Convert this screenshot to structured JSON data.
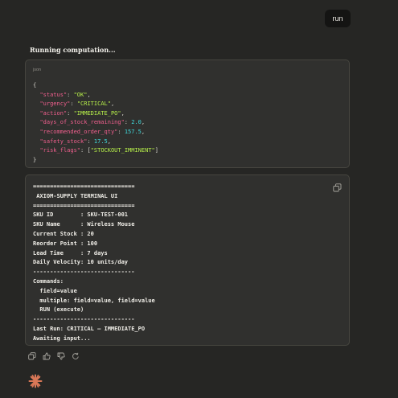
{
  "user_message": "run",
  "status_text": "Running computation...",
  "code_block": {
    "language": "json",
    "open": "{",
    "close": "}",
    "entries": [
      {
        "key": "\"status\"",
        "value": "\"OK\"",
        "type": "string"
      },
      {
        "key": "\"urgency\"",
        "value": "\"CRITICAL\"",
        "type": "string"
      },
      {
        "key": "\"action\"",
        "value": "\"IMMEDIATE_PO\"",
        "type": "string"
      },
      {
        "key": "\"days_of_stock_remaining\"",
        "value": "2.0",
        "type": "number"
      },
      {
        "key": "\"recommended_order_qty\"",
        "value": "157.5",
        "type": "number"
      },
      {
        "key": "\"safety_stock\"",
        "value": "17.5",
        "type": "number"
      },
      {
        "key": "\"risk_flags\"",
        "value": "\"STOCKOUT_IMMINENT\"",
        "type": "array"
      }
    ]
  },
  "terminal": {
    "lines": [
      "==============================",
      " AXIOM-SUPPLY TERMINAL UI",
      "==============================",
      "SKU ID        : SKU-TEST-001",
      "SKU Name      : Wireless Mouse",
      "Current Stock : 20",
      "Reorder Point : 100",
      "Lead Time     : 7 days",
      "Daily Velocity: 10 units/day",
      "------------------------------",
      "Commands:",
      "  field=value",
      "  multiple: field=value, field=value",
      "  RUN (execute)",
      "------------------------------",
      "Last Run: CRITICAL — IMMEDIATE_PO",
      "Awaiting input..."
    ]
  },
  "icons": {
    "copy": "copy-icon",
    "actions": [
      "copy-icon",
      "thumbs-up-icon",
      "thumbs-down-icon",
      "retry-icon"
    ],
    "assistant": "claude-spark-icon"
  },
  "colors": {
    "background": "#262624",
    "card": "#30302e",
    "json_key": "#f05f8e",
    "json_string": "#b7f04a",
    "json_number": "#3fd9dc",
    "brand": "#d97757"
  }
}
